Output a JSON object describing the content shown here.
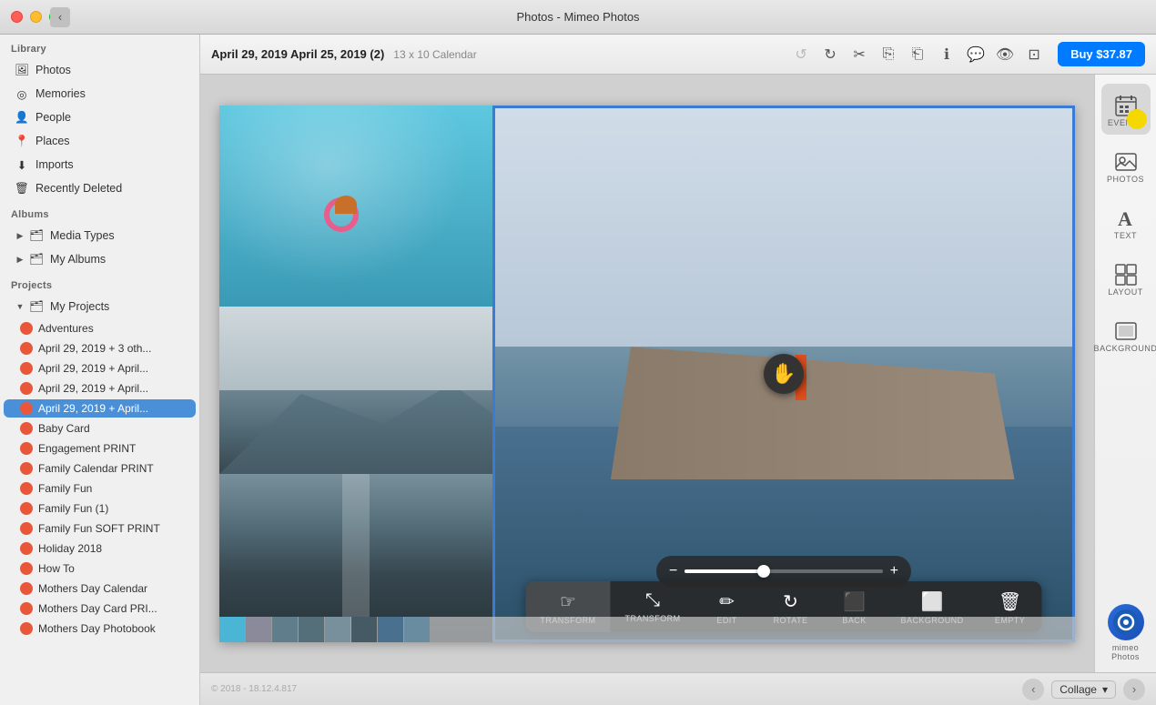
{
  "titlebar": {
    "title": "Photos - Mimeo Photos",
    "back_label": "‹"
  },
  "toolbar": {
    "doc_title": "April 29, 2019 April 25, 2019 (2)",
    "doc_subtitle": "13 x 10 Calendar",
    "buy_label": "Buy $37.87",
    "undo_label": "↺",
    "redo_label": "↻",
    "cut_label": "✂",
    "copy_label": "⎘",
    "paste_label": "⎗",
    "info_label": "ℹ",
    "comment_label": "💬",
    "eye_label": "👁",
    "export_label": "⊡"
  },
  "sidebar": {
    "library_title": "Library",
    "items": [
      {
        "id": "photos",
        "label": "Photos",
        "icon": "🖼"
      },
      {
        "id": "memories",
        "label": "Memories",
        "icon": "◎"
      },
      {
        "id": "people",
        "label": "People",
        "icon": "👤"
      },
      {
        "id": "places",
        "label": "Places",
        "icon": "📍"
      },
      {
        "id": "imports",
        "label": "Imports",
        "icon": "⬇"
      },
      {
        "id": "recently-deleted",
        "label": "Recently Deleted",
        "icon": "🗑"
      }
    ],
    "albums_title": "Albums",
    "album_items": [
      {
        "id": "media-types",
        "label": "Media Types",
        "icon": "🗂"
      },
      {
        "id": "my-albums",
        "label": "My Albums",
        "icon": "🗂"
      }
    ],
    "projects_title": "Projects",
    "my_projects_label": "My Projects",
    "project_items": [
      {
        "id": "adventures",
        "label": "Adventures",
        "color": "#e8573a"
      },
      {
        "id": "apr29",
        "label": "April 29, 2019 + 3 oth...",
        "color": "#e8573a"
      },
      {
        "id": "apr29-2",
        "label": "April 29, 2019 + April...",
        "color": "#e8573a"
      },
      {
        "id": "apr29-3",
        "label": "April 29, 2019 + April...",
        "color": "#e8573a"
      },
      {
        "id": "apr29-4",
        "label": "April 29, 2019 + April...",
        "color": "#e8573a",
        "highlighted": true
      },
      {
        "id": "baby-card",
        "label": "Baby Card",
        "color": "#e8573a"
      },
      {
        "id": "engagement",
        "label": "Engagement PRINT",
        "color": "#e8573a"
      },
      {
        "id": "family-cal",
        "label": "Family Calendar PRINT",
        "color": "#e8573a"
      },
      {
        "id": "family-fun",
        "label": "Family Fun",
        "color": "#e8573a"
      },
      {
        "id": "family-fun-1",
        "label": "Family Fun (1)",
        "color": "#e8573a"
      },
      {
        "id": "family-fun-soft",
        "label": "Family Fun SOFT PRINT",
        "color": "#e8573a"
      },
      {
        "id": "holiday-2018",
        "label": "Holiday 2018",
        "color": "#e8573a"
      },
      {
        "id": "how-to",
        "label": "How To",
        "color": "#e8573a"
      },
      {
        "id": "mothers-day-cal",
        "label": "Mothers Day Calendar",
        "color": "#e8573a"
      },
      {
        "id": "mothers-day-card",
        "label": "Mothers Day Card PRI...",
        "color": "#e8573a"
      },
      {
        "id": "mothers-day-photo",
        "label": "Mothers Day Photobook",
        "color": "#e8573a"
      }
    ]
  },
  "right_panel": {
    "buttons": [
      {
        "id": "events",
        "label": "EVENTS",
        "icon": "📅"
      },
      {
        "id": "photos-panel",
        "label": "PHOTOS",
        "icon": "🖼"
      },
      {
        "id": "text",
        "label": "TEXT",
        "icon": "A"
      },
      {
        "id": "layout",
        "label": "LAYOUT",
        "icon": "⊞"
      },
      {
        "id": "background",
        "label": "BACKGROUND",
        "icon": "⬜"
      }
    ]
  },
  "photo_tools": {
    "tools": [
      {
        "id": "transform",
        "label": "TRANSFORM",
        "icon": "☞"
      },
      {
        "id": "transform-scale",
        "label": "TRANSFORM",
        "icon": "⤡"
      },
      {
        "id": "edit",
        "label": "EDIT",
        "icon": "✏"
      },
      {
        "id": "rotate",
        "label": "ROTATE",
        "icon": "↻"
      },
      {
        "id": "back",
        "label": "BACK",
        "icon": "⬛"
      },
      {
        "id": "background-tool",
        "label": "BACKGROUND",
        "icon": "⬜"
      },
      {
        "id": "empty",
        "label": "EMPTY",
        "icon": "🗑"
      }
    ]
  },
  "bottom_bar": {
    "page_type": "Collage",
    "copyright": "© 2018 - 18.12.4.817"
  },
  "slider": {
    "min_icon": "−",
    "max_icon": "+"
  },
  "mimeo_logo": {
    "letter": "m",
    "text": "mimeo"
  }
}
